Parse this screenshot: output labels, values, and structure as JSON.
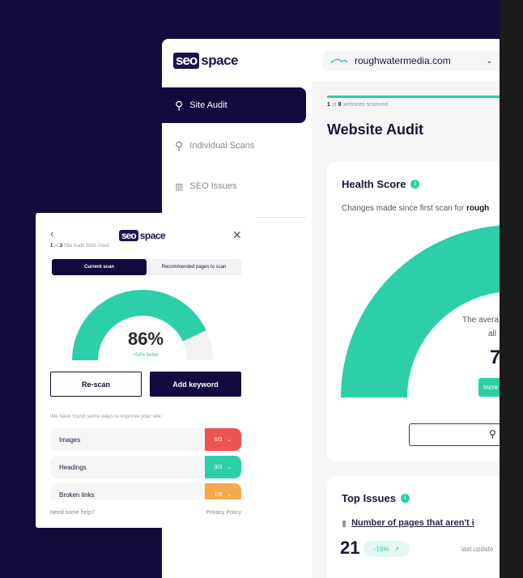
{
  "app": {
    "logo_box": "seo",
    "logo_text": "space"
  },
  "header": {
    "domain": "roughwatermedia.com"
  },
  "sidebar": {
    "items": [
      {
        "label": "Site Audit",
        "icon": "search-icon",
        "active": true
      },
      {
        "label": "Individual Scans",
        "icon": "search-icon"
      },
      {
        "label": "SEO Issues",
        "icon": "bar-chart-icon"
      }
    ]
  },
  "main": {
    "progress": {
      "scanned": "1",
      "total": "9",
      "text": "websites scanned",
      "fraction": 0.111
    },
    "title": "Website Audit",
    "health": {
      "title": "Health Score",
      "subtitle_prefix": "Changes made since first scan for ",
      "subtitle_domain": "rough",
      "avg_line1": "The avera",
      "avg_line2": "all",
      "avg_value": "7",
      "increase_button": "Incre"
    },
    "top_issues": {
      "title": "Top Issues",
      "issue": "Number of pages that aren't i",
      "count": "21",
      "change": "-16%",
      "last_updated": "last update"
    }
  },
  "popup": {
    "slots_used": "1",
    "slots_total": "3",
    "slots_text": "Site Audit Slots Used",
    "of": "of",
    "tabs": [
      "Current scan",
      "Recommended pages to scan"
    ],
    "score": "86%",
    "score_value": 0.86,
    "change": "+54% better",
    "rescan": "Re-scan",
    "add_keyword": "Add keyword",
    "found_text": "We have found some ways to improve your site:",
    "rows": [
      {
        "label": "Images",
        "value": "0/3",
        "color": "#ef5350"
      },
      {
        "label": "Headings",
        "value": "3/3",
        "color": "#2ccfa8"
      },
      {
        "label": "Broken links",
        "value": "1/3",
        "color": "#f5a94a"
      }
    ],
    "help": "Need some help?",
    "privacy": "Privacy Policy"
  },
  "colors": {
    "accent": "#2ccfa8",
    "navy": "#120a3d"
  }
}
